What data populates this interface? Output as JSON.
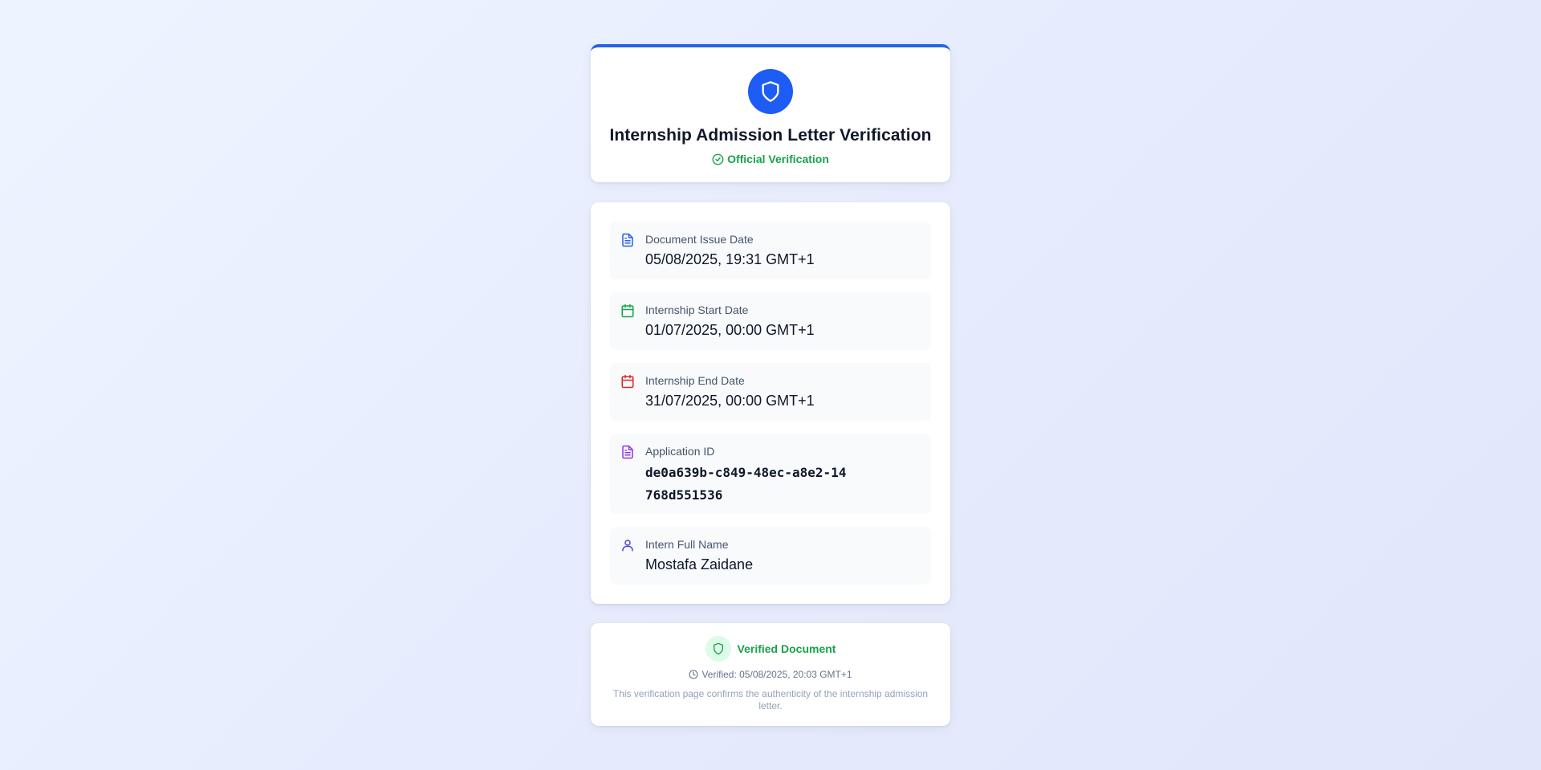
{
  "header": {
    "title": "Internship Admission Letter Verification",
    "badge": "Official Verification",
    "icon": "shield-icon"
  },
  "fields": [
    {
      "label": "Document Issue Date",
      "value": "05/08/2025, 19:31 GMT+1",
      "icon": "file-text-icon",
      "color": "#2563eb"
    },
    {
      "label": "Internship Start Date",
      "value": "01/07/2025, 00:00 GMT+1",
      "icon": "calendar-icon",
      "color": "#16a34a"
    },
    {
      "label": "Internship End Date",
      "value": "31/07/2025, 00:00 GMT+1",
      "icon": "calendar-icon",
      "color": "#dc2626"
    },
    {
      "label": "Application ID",
      "value": "de0a639b-c849-48ec-a8e2-14768d551536",
      "icon": "file-text-icon",
      "color": "#9333ea"
    },
    {
      "label": "Intern Full Name",
      "value": "Mostafa Zaidane",
      "icon": "user-icon",
      "color": "#4f46e5"
    }
  ],
  "footer": {
    "status": "Verified Document",
    "verified_at": "Verified: 05/08/2025, 20:03 GMT+1",
    "note": "This verification page confirms the authenticity of the internship admission letter."
  },
  "colors": {
    "primary": "#1d5cf5",
    "success": "#16a34a",
    "danger": "#dc2626",
    "purple": "#9333ea",
    "indigo": "#4f46e5"
  }
}
